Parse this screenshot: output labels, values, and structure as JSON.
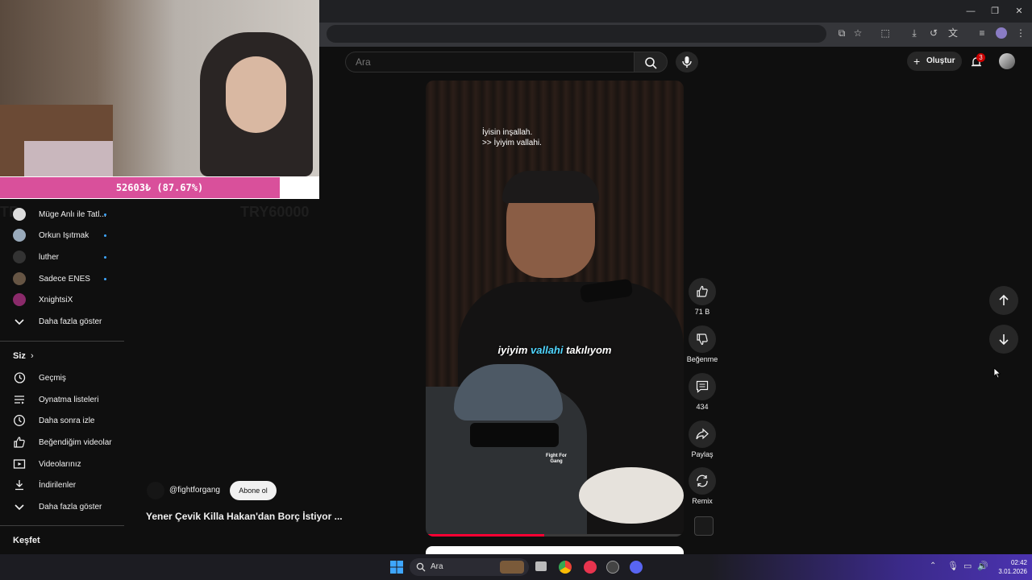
{
  "header": {
    "search_placeholder": "Ara",
    "create_label": "Oluştur",
    "notification_count": "3"
  },
  "overlay": {
    "donation_text": "52603₺ (87.67%)",
    "donation_progress": 0.8767,
    "goal_text": "TRY60000",
    "left_fade_text": "TR"
  },
  "sidebar": {
    "subscriptions": [
      {
        "label": "Müge Anlı ile Tatl...",
        "new": true
      },
      {
        "label": "Orkun Işıtmak",
        "new": true
      },
      {
        "label": "luther",
        "new": true
      },
      {
        "label": "Sadece ENES",
        "new": true
      },
      {
        "label": "XnightsiX",
        "new": false
      }
    ],
    "show_more_1": "Daha fazla göster",
    "you_label": "Siz",
    "you_items": [
      {
        "label": "Geçmiş",
        "icon": "history-icon"
      },
      {
        "label": "Oynatma listeleri",
        "icon": "playlists-icon"
      },
      {
        "label": "Daha sonra izle",
        "icon": "watch-later-icon"
      },
      {
        "label": "Beğendiğim videolar",
        "icon": "liked-icon"
      },
      {
        "label": "Videolarınız",
        "icon": "your-videos-icon"
      },
      {
        "label": "İndirilenler",
        "icon": "downloads-icon"
      }
    ],
    "show_more_2": "Daha fazla göster",
    "explore_label": "Keşfet"
  },
  "short": {
    "caption_line1": "İyisin inşallah.",
    "caption_line2": ">> İyiyim vallahi.",
    "subtitle_pre": "iyiyim ",
    "subtitle_highlight": "vallahi",
    "subtitle_post": " takılıyom",
    "watermark": "Fight For Gang",
    "channel": "@fightforgang",
    "subscribe_label": "Abone ol",
    "title": "Yener Çevik Killa Hakan'dan Borç İstiyor ...",
    "likes": "71 B",
    "dislike_label": "Beğenme",
    "comments": "434",
    "share_label": "Paylaş",
    "remix_label": "Remix"
  },
  "taskbar": {
    "search_label": "Ara",
    "time": "02:42",
    "date": "3.01.2026"
  }
}
